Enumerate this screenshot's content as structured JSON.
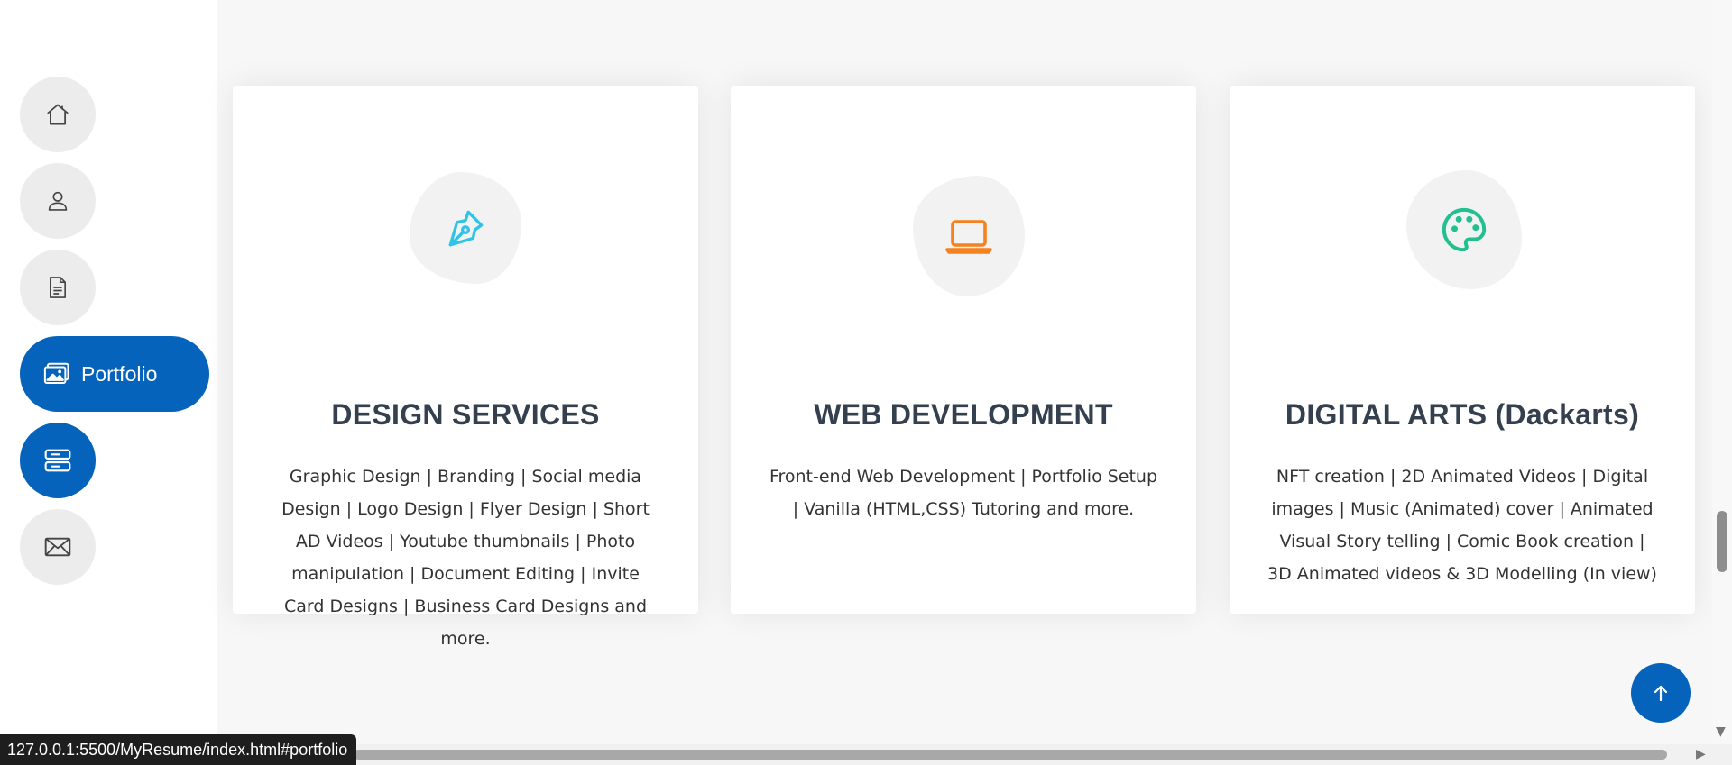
{
  "sidebar": {
    "items": [
      {
        "icon": "home-icon"
      },
      {
        "icon": "person-icon"
      },
      {
        "icon": "document-icon"
      },
      {
        "icon": "image-icon",
        "label": "Portfolio"
      },
      {
        "icon": "server-icon"
      },
      {
        "icon": "envelope-icon"
      }
    ]
  },
  "services": [
    {
      "icon": "pen-nib-icon",
      "icon_color": "#2ec4e8",
      "title": "DESIGN SERVICES",
      "description": "Graphic Design | Branding | Social media Design | Logo Design | Flyer Design | Short AD Videos | Youtube thumbnails | Photo manipulation | Document Editing | Invite Card Designs | Business Card Designs and more."
    },
    {
      "icon": "laptop-icon",
      "icon_color": "#f5821f",
      "title": "WEB DEVELOPMENT",
      "description": "Front-end Web Development | Portfolio Setup | Vanilla (HTML,CSS) Tutoring and more."
    },
    {
      "icon": "palette-icon",
      "icon_color": "#21c18f",
      "title": "DIGITAL ARTS (Dackarts)",
      "description": "NFT creation | 2D Animated Videos | Digital images | Music (Animated) cover | Animated Visual Story telling | Comic Book creation | 3D Animated videos & 3D Modelling (In view)"
    }
  ],
  "back_to_top": {
    "icon": "arrow-up-icon"
  },
  "status_bar": {
    "url": "127.0.0.1:5500/MyResume/index.html#portfolio"
  },
  "colors": {
    "accent": "#0563bb",
    "nav_inactive": "#ececec",
    "heading": "#35404e"
  }
}
